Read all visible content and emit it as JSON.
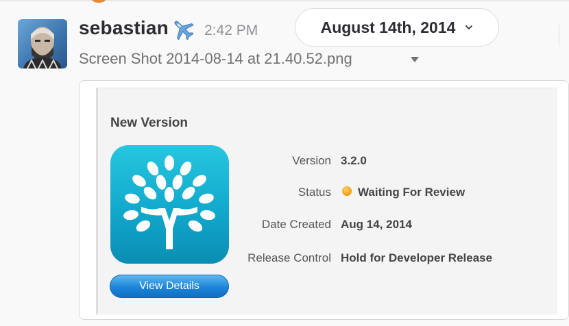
{
  "message": {
    "sender": "sebastian",
    "sender_icon": "airplane-icon",
    "time": "2:42 PM",
    "date_divider": "August 14th, 2014",
    "filename": "Screen Shot 2014-08-14 at 21.40.52.png"
  },
  "screenshot": {
    "title": "New Version",
    "button_label": "View Details",
    "fields": [
      {
        "label": "Version",
        "value": "3.2.0"
      },
      {
        "label": "Status",
        "value": "Waiting For Review"
      },
      {
        "label": "Date Created",
        "value": "Aug 14, 2014"
      },
      {
        "label": "Release Control",
        "value": "Hold for Developer Release"
      }
    ]
  },
  "colors": {
    "accent_blue": "#1c85d9",
    "app_icon_teal": "#11a9cc",
    "status_orange": "#f5a21a"
  }
}
